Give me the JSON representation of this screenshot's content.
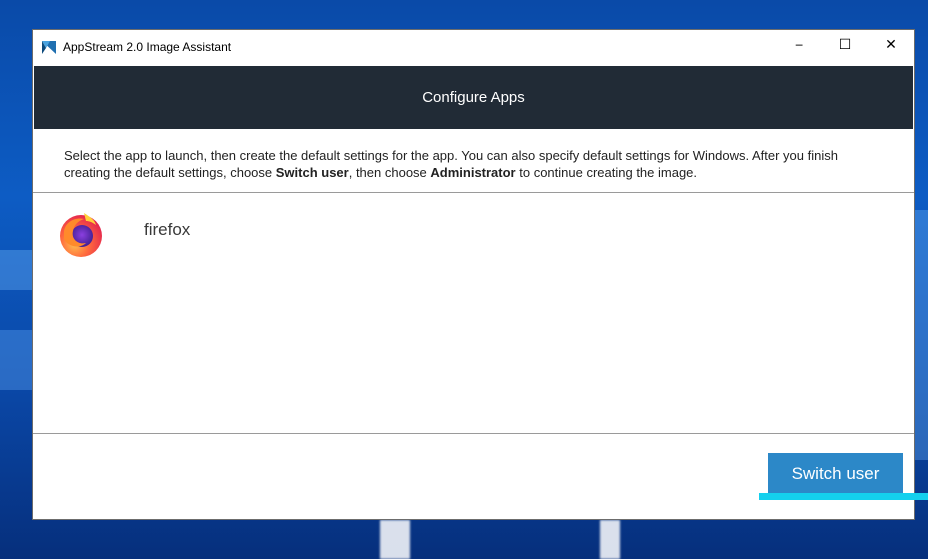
{
  "window": {
    "title": "AppStream 2.0 Image Assistant",
    "controls": {
      "minimize": "─",
      "maximize": "☐",
      "close": "✕"
    }
  },
  "banner": {
    "title": "Configure Apps"
  },
  "instructions": {
    "part1": "Select the app to launch, then create the default settings for the app. You can also specify default settings for Windows. After you finish creating the default settings, choose ",
    "bold1": "Switch user",
    "part2": ", then choose ",
    "bold2": "Administrator",
    "part3": " to continue creating the image."
  },
  "apps": [
    {
      "label": "firefox",
      "icon": "firefox-icon"
    }
  ],
  "footer": {
    "switch_user_label": "Switch user"
  },
  "colors": {
    "banner_bg": "#212b36",
    "button_bg": "#2c88c8",
    "focus_accent": "#14d0ee"
  }
}
